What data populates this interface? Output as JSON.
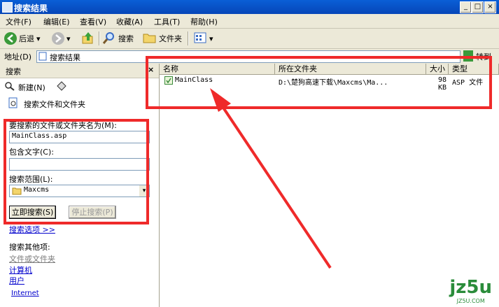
{
  "window": {
    "title": "搜索结果",
    "min": "_",
    "max": "□",
    "close": "×"
  },
  "menu": {
    "items": [
      "文件(F)",
      "编辑(E)",
      "查看(V)",
      "收藏(A)",
      "工具(T)",
      "帮助(H)"
    ]
  },
  "toolbar": {
    "back": "后退",
    "search": "搜索",
    "folders": "文件夹",
    "dropdown": "▾"
  },
  "address": {
    "label": "地址(D)",
    "value": "搜索结果",
    "go": "转到"
  },
  "left": {
    "header": "搜索",
    "close": "×",
    "new_label": "新建(N)",
    "section_title": "搜索文件和文件夹",
    "name_label": "要搜索的文件或文件夹名为(M):",
    "name_value": "MainClass.asp",
    "contains_label": "包含文字(C):",
    "contains_value": "",
    "scope_label": "搜索范围(L):",
    "scope_value": "Maxcms",
    "search_now": "立即搜索(S)",
    "stop_search": "停止搜索(P)",
    "options_link": "搜索选项 >>",
    "other_title": "搜索其他项:",
    "other_items": [
      "文件或文件夹",
      "计算机",
      "用户",
      "Internet"
    ]
  },
  "results": {
    "columns": [
      "名称",
      "所在文件夹",
      "大小",
      "类型"
    ],
    "rows": [
      {
        "name": "MainClass",
        "folder": "D:\\楚狗高速下载\\Maxcms\\Ma...",
        "size": "98 KB",
        "type": "ASP 文件"
      }
    ]
  },
  "watermark": {
    "text": "jz5u",
    "sub": "JZ5U.COM"
  },
  "colors": {
    "annotation_red": "#ef2a2a",
    "title_blue": "#0a5fd6"
  }
}
